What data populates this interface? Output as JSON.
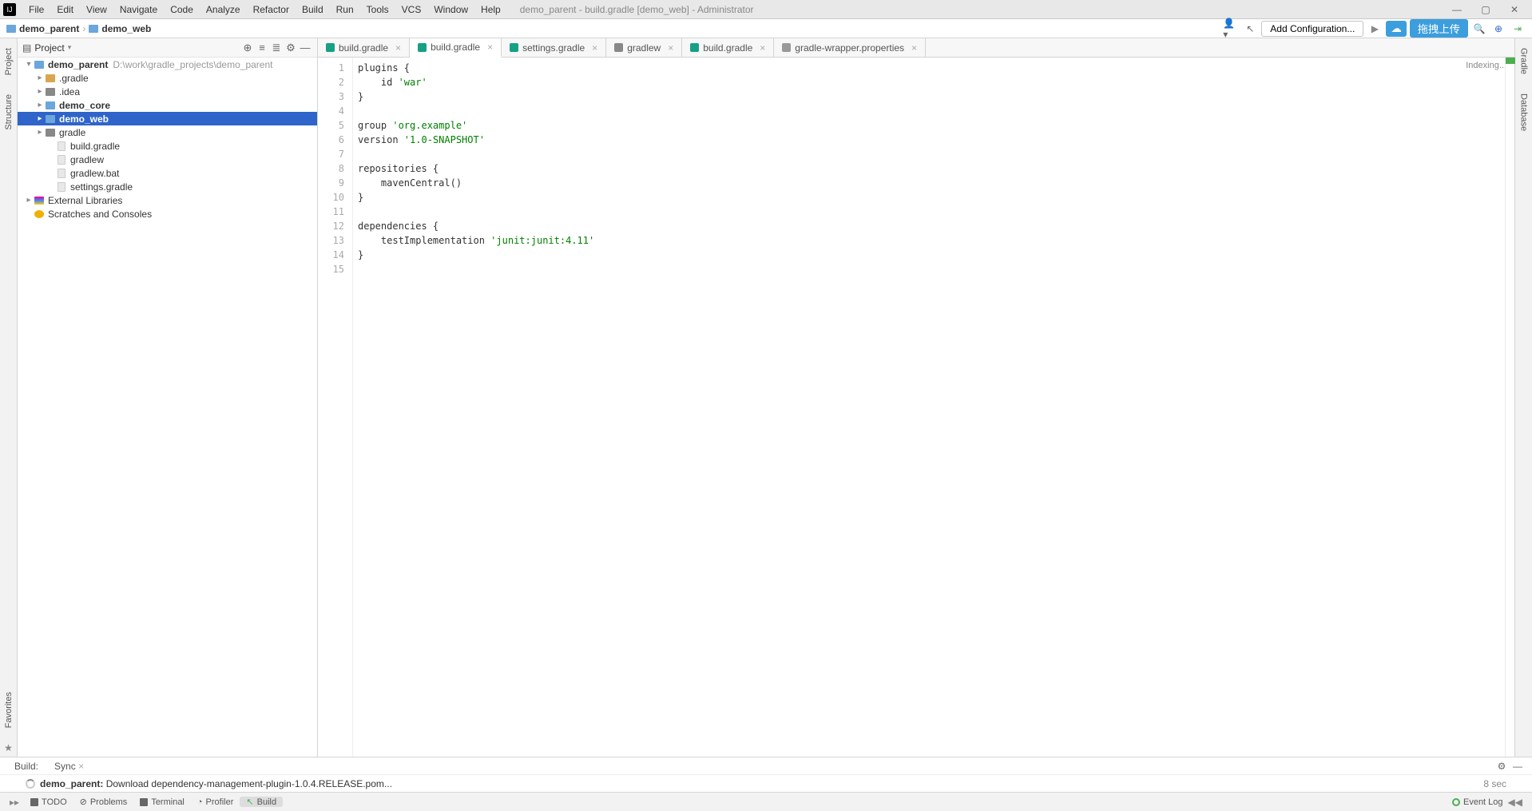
{
  "titlebar": {
    "menus": [
      "File",
      "Edit",
      "View",
      "Navigate",
      "Code",
      "Analyze",
      "Refactor",
      "Build",
      "Run",
      "Tools",
      "VCS",
      "Window",
      "Help"
    ],
    "title": "demo_parent - build.gradle [demo_web] - Administrator"
  },
  "breadcrumbs": {
    "items": [
      "demo_parent",
      "demo_web"
    ]
  },
  "navright": {
    "add_config": "Add Configuration...",
    "blue_btn": "拖拽上传"
  },
  "project_panel": {
    "title": "Project",
    "root": "demo_parent",
    "root_path": "D:\\work\\gradle_projects\\demo_parent",
    "children": [
      ".gradle",
      ".idea",
      "demo_core",
      "demo_web",
      "gradle",
      "build.gradle",
      "gradlew",
      "gradlew.bat",
      "settings.gradle"
    ],
    "external_libs": "External Libraries",
    "scratches": "Scratches and Consoles"
  },
  "editor_tabs": [
    "build.gradle",
    "build.gradle",
    "settings.gradle",
    "gradlew",
    "build.gradle",
    "gradle-wrapper.properties"
  ],
  "active_tab_index": 1,
  "code": {
    "lines": [
      "plugins {",
      "    id 'war'",
      "}",
      "",
      "group 'org.example'",
      "version '1.0-SNAPSHOT'",
      "",
      "repositories {",
      "    mavenCentral()",
      "}",
      "",
      "dependencies {",
      "    testImplementation 'junit:junit:4.11'",
      "}",
      ""
    ],
    "indexing": "Indexing..."
  },
  "build": {
    "label": "Build:",
    "sync": "Sync",
    "project": "demo_parent:",
    "message": " Download dependency-management-plugin-1.0.4.RELEASE.pom...",
    "time": "8 sec"
  },
  "bottom_tabs": [
    "TODO",
    "Problems",
    "Terminal",
    "Profiler",
    "Build"
  ],
  "event_log": "Event Log",
  "left_gutters": [
    "Project",
    "Structure",
    "Favorites"
  ],
  "right_gutters": [
    "Gradle",
    "Database"
  ]
}
